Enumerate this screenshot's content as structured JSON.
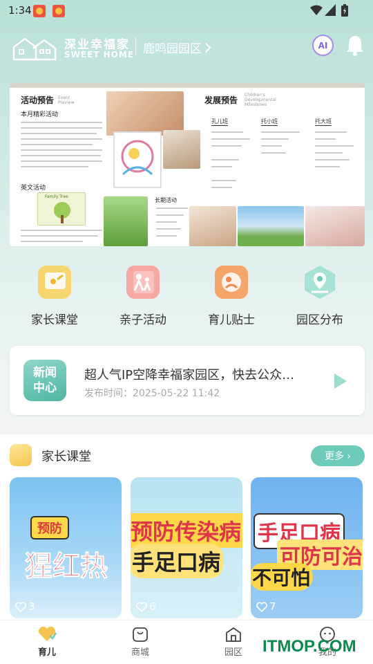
{
  "status_bar": {
    "time": "1:34"
  },
  "header": {
    "logo_cn": "深业幸福家",
    "logo_en": "SWEET HOME",
    "campus": "鹿鸣园园区",
    "ai_label": "AI"
  },
  "banner": {
    "activity_title": "活动预告",
    "activity_sub": "Event Preview",
    "subheading1": "本月精彩活动",
    "subheading2": "英文活动",
    "card_text": "Family Tree",
    "dev_title": "发展预告",
    "dev_sub": "Children's Developmental Milestones",
    "col1": "孔儿班",
    "col2": "托小班",
    "col3": "托大班",
    "bottom_title": "长期活动"
  },
  "categories": [
    {
      "label": "家长课堂",
      "icon": "classroom-icon"
    },
    {
      "label": "亲子活动",
      "icon": "family-icon"
    },
    {
      "label": "育儿贴士",
      "icon": "parenting-tips-icon"
    },
    {
      "label": "园区分布",
      "icon": "map-pin-icon"
    }
  ],
  "news": {
    "badge_line1": "新闻",
    "badge_line2": "中心",
    "title": "超人气IP空降幸福家园区，快去公众…",
    "date": "发布时间：2025-05-22 11:42"
  },
  "section": {
    "title": "家长课堂",
    "more_label": "更多 ›"
  },
  "courses": [
    {
      "tag": "预防",
      "text": "猩红热",
      "likes": "3"
    },
    {
      "tag": "",
      "text": "预防传染病",
      "text2": "手足口病",
      "likes": "6"
    },
    {
      "tag": "",
      "text": "手足口病",
      "text2": "可防可治",
      "text3": "不可怕",
      "likes": "7"
    }
  ],
  "bottom_nav": [
    {
      "label": "育儿",
      "active": true
    },
    {
      "label": "商城",
      "active": false
    },
    {
      "label": "园区",
      "active": false
    },
    {
      "label": "我的",
      "active": false
    }
  ],
  "watermark": "ITMOP.COM",
  "colors": {
    "accent": "#6ccbb9",
    "news_badge": "#4fb6a3"
  }
}
